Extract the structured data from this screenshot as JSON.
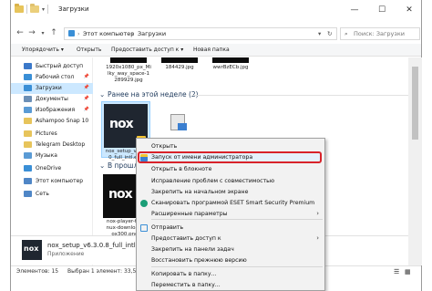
{
  "titlebar": {
    "title": "Загрузки"
  },
  "window_controls": {
    "minimize": "—",
    "maximize": "☐",
    "close": "✕"
  },
  "address": {
    "crumbs": [
      "Этот компьютер",
      "Загрузки"
    ],
    "separator": "›",
    "search_placeholder": "Поиск: Загрузки"
  },
  "toolbar": {
    "organize": "Упорядочить ▾",
    "open": "Открыть",
    "share": "Предоставить доступ к ▾",
    "new_folder": "Новая папка"
  },
  "sidebar": {
    "items": [
      {
        "label": "Быстрый доступ",
        "icon": "star-icon",
        "color": "#3b78c9"
      },
      {
        "label": "Рабочий стол",
        "icon": "desktop-icon",
        "color": "#3a8fd6",
        "pinned": true
      },
      {
        "label": "Загрузки",
        "icon": "download-icon",
        "color": "#3a8fd6",
        "pinned": true,
        "selected": true
      },
      {
        "label": "Документы",
        "icon": "documents-icon",
        "color": "#6b8fb6",
        "pinned": true
      },
      {
        "label": "Изображения",
        "icon": "pictures-icon",
        "color": "#5a9bd5",
        "pinned": true
      },
      {
        "label": "Ashampoo Snap 10",
        "icon": "folder-icon",
        "color": "#e7c45b"
      },
      {
        "label": "Pictures",
        "icon": "folder-icon",
        "color": "#e7c45b"
      },
      {
        "label": "Telegram Desktop",
        "icon": "folder-icon",
        "color": "#e7c45b"
      },
      {
        "label": "Музыка",
        "icon": "music-icon",
        "color": "#5a9bd5"
      },
      {
        "label": "OneDrive",
        "icon": "cloud-icon",
        "color": "#3a8fd6"
      },
      {
        "label": "Этот компьютер",
        "icon": "computer-icon",
        "color": "#4f86c6"
      },
      {
        "label": "Сеть",
        "icon": "network-icon",
        "color": "#4f86c6"
      }
    ],
    "pin_glyph": "📌"
  },
  "content": {
    "top_files": [
      {
        "caption": "1920x1080_px_Mi lky_way_space-1 289929.jpg"
      },
      {
        "caption": "184429.jpg"
      },
      {
        "caption": "wwrBzECb.jpg"
      }
    ],
    "section_earlier": "Ранее на этой неделе (2)",
    "section_older": "В прошлом",
    "nox_caption_selected": "nox_setup_v6.3. 0_full_intl.exe",
    "nox_caption_second": "nox-player-for- nux-download- ox300.png",
    "nox_logo": "nox"
  },
  "details": {
    "file_name": "nox_setup_v6.3.0.8_full_intl.exe",
    "file_type": "Приложение"
  },
  "status": {
    "count": "Элементов: 15",
    "selected": "Выбран 1 элемент: 33,5 МБ"
  },
  "context_menu": {
    "items": [
      {
        "label": "Открыть",
        "icon": ""
      },
      {
        "label": "Запуск от имени администратора",
        "icon": "shield-icon",
        "highlight": true
      },
      {
        "label": "Открыть в блокноте",
        "icon": ""
      },
      {
        "label": "Исправление проблем с совместимостью",
        "icon": ""
      },
      {
        "label": "Закрепить на начальном экране",
        "icon": ""
      },
      {
        "label": "Сканировать программой ESET Smart Security Premium",
        "icon": "eset-icon"
      },
      {
        "label": "Расширенные параметры",
        "icon": "",
        "submenu": true
      },
      {
        "label": "Отправить",
        "icon": "share-icon"
      },
      {
        "label": "Предоставить доступ к",
        "icon": "",
        "submenu": true
      },
      {
        "label": "Закрепить на панели задач",
        "icon": ""
      },
      {
        "label": "Восстановить прежнюю версию",
        "icon": ""
      },
      {
        "label": "Копировать в папку...",
        "icon": ""
      },
      {
        "label": "Переместить в папку...",
        "icon": ""
      }
    ],
    "submenu_glyph": "›",
    "highlight_color": "#d8232a"
  }
}
